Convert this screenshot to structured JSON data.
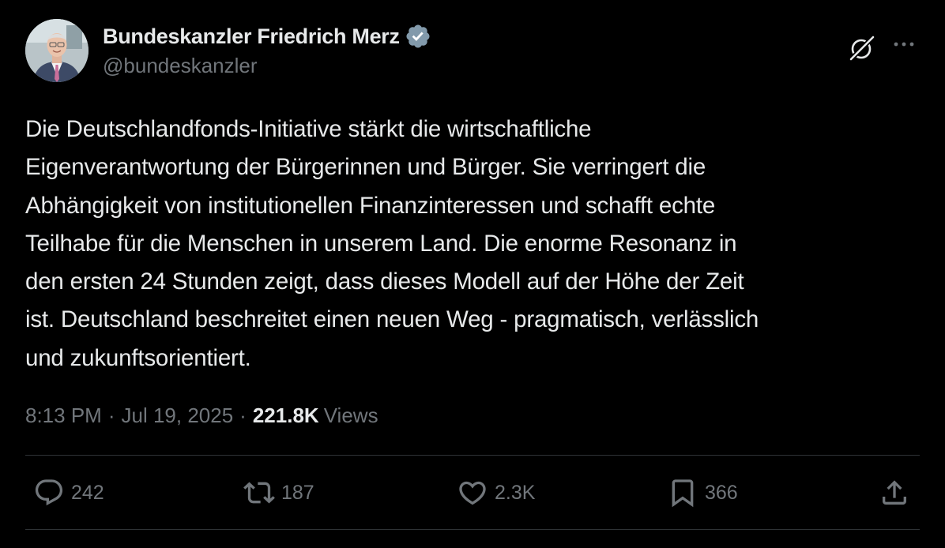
{
  "author": {
    "display_name": "Bundeskanzler Friedrich Merz",
    "handle": "@bundeskanzler",
    "verified_icon": "verified-badge-icon",
    "verified_color": "#829aab"
  },
  "header_actions": {
    "grok_icon": "grok-icon",
    "more_icon": "more-horizontal-icon"
  },
  "post": {
    "text": "Die Deutschlandfonds-Initiative stärkt die wirtschaftliche\nEigenverantwortung der Bürgerinnen und Bürger. Sie verringert die\nAbhängigkeit von institutionellen Finanzinteressen und schafft echte\nTeilhabe für die Menschen in unserem Land. Die enorme Resonanz in\nden ersten 24 Stunden zeigt, dass dieses Modell auf der Höhe der Zeit\nist. Deutschland beschreitet einen neuen Weg - pragmatisch, verlässlich\nund zukunftsorientiert."
  },
  "meta": {
    "time": "8:13 PM",
    "separator": "·",
    "date": "Jul 19, 2025",
    "views_count": "221.8K",
    "views_label": "Views"
  },
  "actions": {
    "reply": {
      "icon": "reply-icon",
      "count": "242"
    },
    "retweet": {
      "icon": "retweet-icon",
      "count": "187"
    },
    "like": {
      "icon": "heart-icon",
      "count": "2.3K"
    },
    "bookmark": {
      "icon": "bookmark-icon",
      "count": "366"
    },
    "share": {
      "icon": "share-icon"
    }
  },
  "colors": {
    "background": "#000000",
    "text_primary": "#e7e9ea",
    "text_secondary": "#71767b",
    "divider": "#2f3336"
  }
}
